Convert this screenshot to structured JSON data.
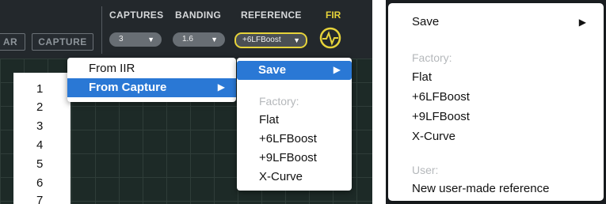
{
  "header": {
    "left_partial_button": "AR",
    "capture_button": "CAPTURE",
    "captures": {
      "label": "CAPTURES",
      "value": "3"
    },
    "banding": {
      "label": "BANDING",
      "value": "1.6"
    },
    "reference": {
      "label": "REFERENCE",
      "value": "+6LFBoost"
    },
    "fir": {
      "label": "FIR",
      "icon": "headphones-power-icon",
      "accent": "#e6d33a"
    }
  },
  "source_menu": {
    "items": [
      "From IIR",
      "From Capture"
    ],
    "highlight_color": "#2a78d5"
  },
  "capture_numbers": [
    "1",
    "2",
    "3",
    "4",
    "5",
    "6",
    "7"
  ],
  "reference_submenu": {
    "save_label": "Save",
    "factory_label": "Factory:",
    "factory_items": [
      "Flat",
      "+6LFBoost",
      "+9LFBoost",
      "X-Curve"
    ]
  },
  "right_menu": {
    "save_label": "Save",
    "factory_label": "Factory:",
    "factory_items": [
      "Flat",
      "+6LFBoost",
      "+9LFBoost",
      "X-Curve"
    ],
    "user_label": "User:",
    "user_items": [
      "New user-made reference"
    ]
  }
}
